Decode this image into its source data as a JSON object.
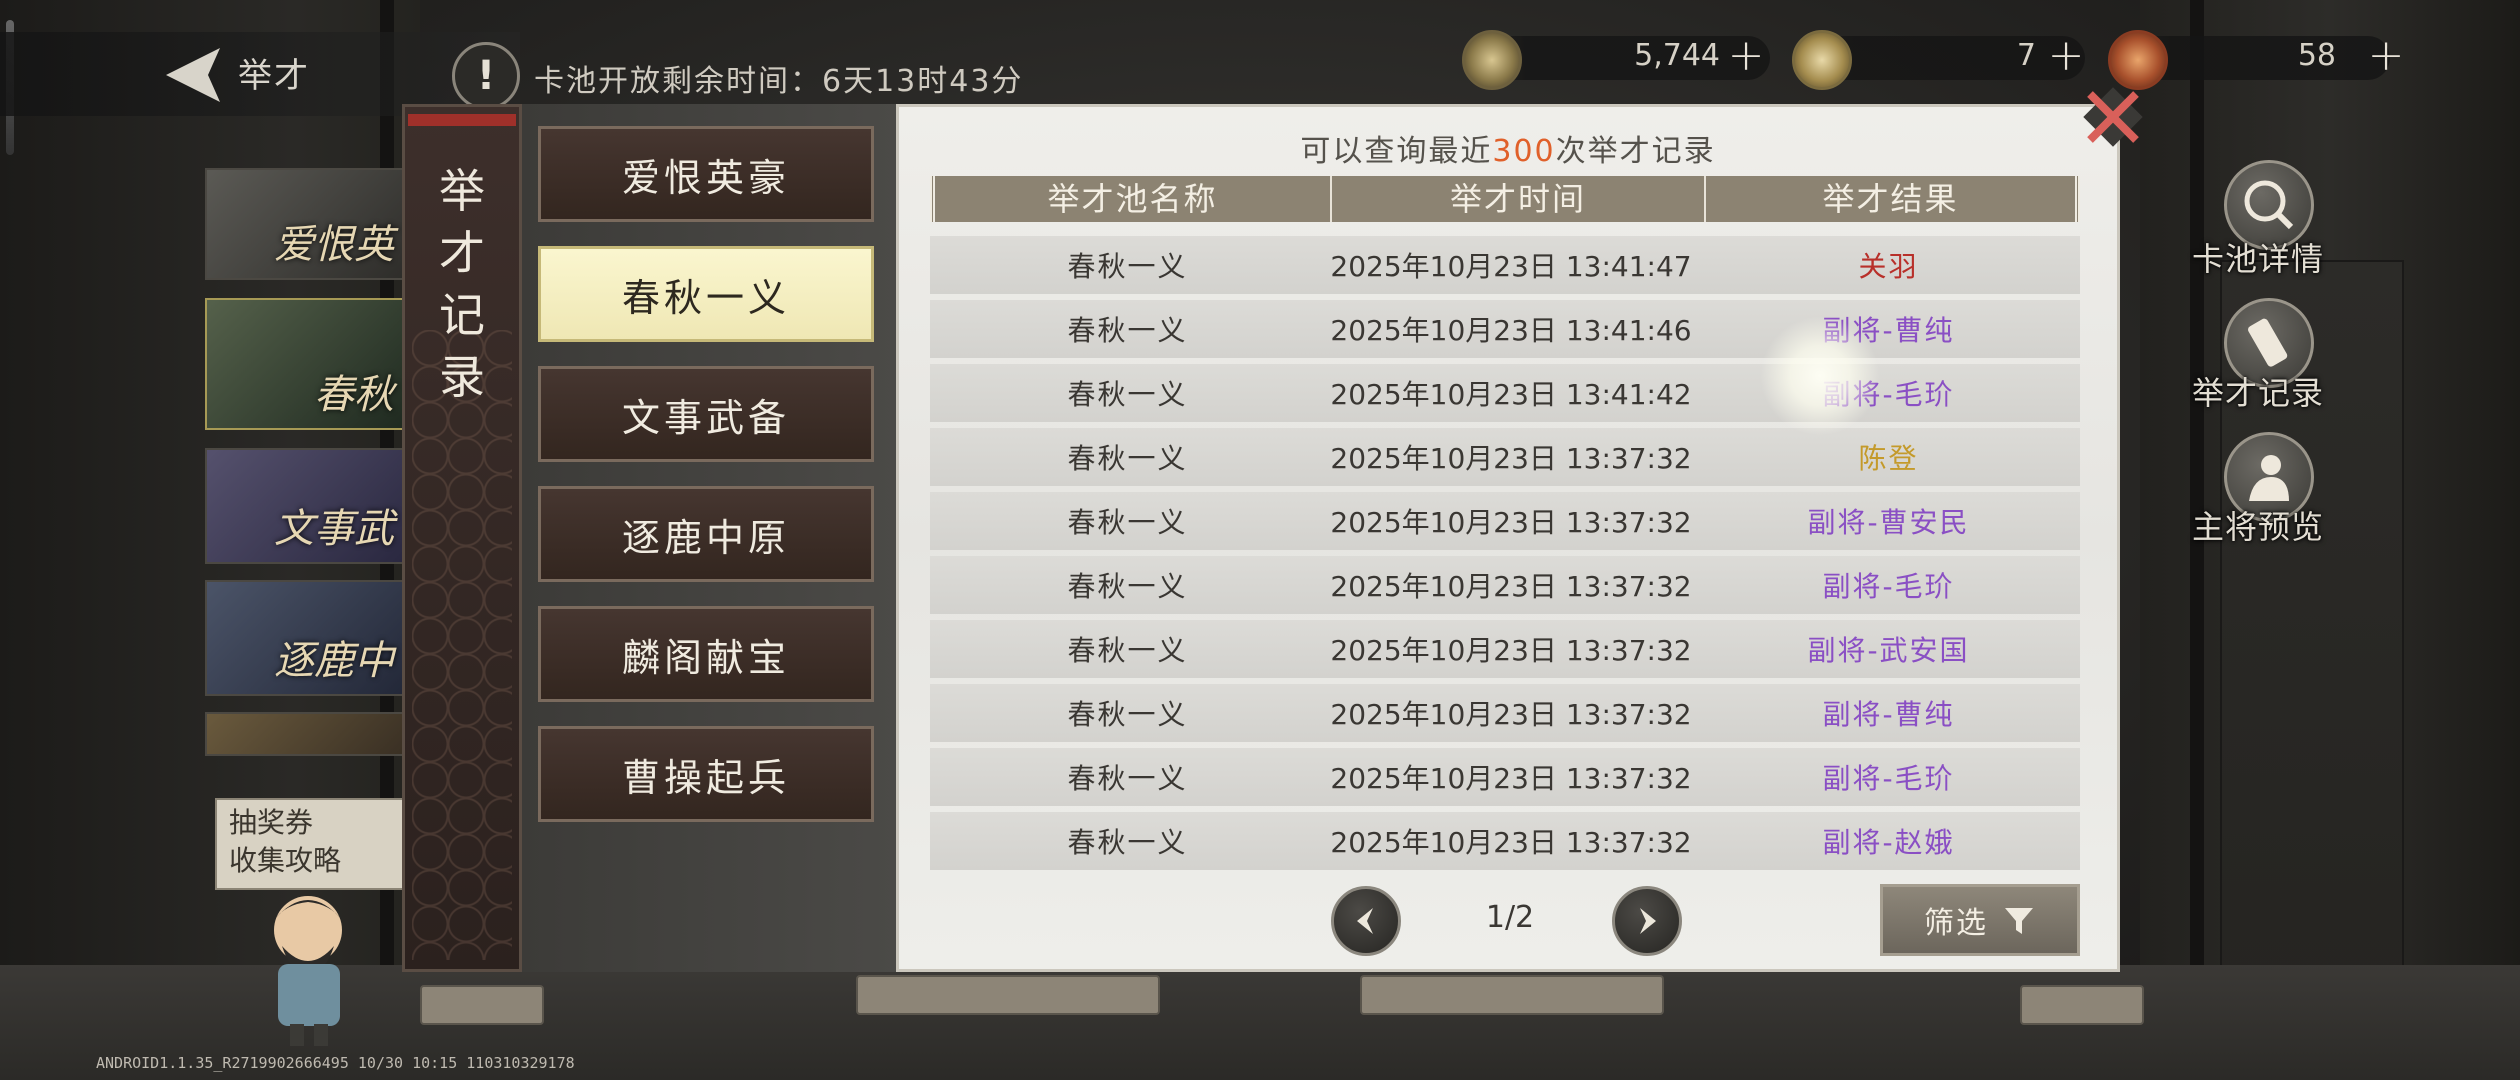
{
  "header": {
    "back_label": "举才",
    "warning_glyph": "!",
    "timer_text": "卡池开放剩余时间：6天13时43分"
  },
  "currencies": [
    {
      "icon": "copper-coin-icon",
      "value": "5,744",
      "plus": "+"
    },
    {
      "icon": "jade-token-icon",
      "value": "7",
      "plus": "+"
    },
    {
      "icon": "gold-ticket-icon",
      "value": "58",
      "plus": "+"
    }
  ],
  "side_buttons": [
    {
      "icon": "magnifier-icon",
      "label": "卡池详情"
    },
    {
      "icon": "scroll-icon",
      "label": "举才记录"
    },
    {
      "icon": "general-icon",
      "label": "主将预览"
    }
  ],
  "banners": [
    {
      "text": "爱恨英"
    },
    {
      "text": "春秋"
    },
    {
      "text": "文事武"
    },
    {
      "text": "逐鹿中"
    }
  ],
  "voucher": {
    "line1": "抽奖券",
    "line2": "收集攻略"
  },
  "modal": {
    "tab_title": "举才记录",
    "pools": [
      {
        "label": "爱恨英豪",
        "active": false
      },
      {
        "label": "春秋一义",
        "active": true
      },
      {
        "label": "文事武备",
        "active": false
      },
      {
        "label": "逐鹿中原",
        "active": false
      },
      {
        "label": "麟阁献宝",
        "active": false
      },
      {
        "label": "曹操起兵",
        "active": false
      }
    ],
    "note_prefix": "可以查询最近",
    "note_number": "300",
    "note_suffix": "次举才记录",
    "columns": [
      "举才池名称",
      "举才时间",
      "举才结果"
    ],
    "rows": [
      {
        "pool": "春秋一义",
        "time": "2025年10月23日 13:41:47",
        "result": "关羽",
        "color": "#b8302a"
      },
      {
        "pool": "春秋一义",
        "time": "2025年10月23日 13:41:46",
        "result": "副将-曹纯",
        "color": "#8a4fc4"
      },
      {
        "pool": "春秋一义",
        "time": "2025年10月23日 13:41:42",
        "result": "副将-毛玠",
        "color": "#8a4fc4"
      },
      {
        "pool": "春秋一义",
        "time": "2025年10月23日 13:37:32",
        "result": "陈登",
        "color": "#c49a2a"
      },
      {
        "pool": "春秋一义",
        "time": "2025年10月23日 13:37:32",
        "result": "副将-曹安民",
        "color": "#8a4fc4"
      },
      {
        "pool": "春秋一义",
        "time": "2025年10月23日 13:37:32",
        "result": "副将-毛玠",
        "color": "#8a4fc4"
      },
      {
        "pool": "春秋一义",
        "time": "2025年10月23日 13:37:32",
        "result": "副将-武安国",
        "color": "#8a4fc4"
      },
      {
        "pool": "春秋一义",
        "time": "2025年10月23日 13:37:32",
        "result": "副将-曹纯",
        "color": "#8a4fc4"
      },
      {
        "pool": "春秋一义",
        "time": "2025年10月23日 13:37:32",
        "result": "副将-毛玠",
        "color": "#8a4fc4"
      },
      {
        "pool": "春秋一义",
        "time": "2025年10月23日 13:37:32",
        "result": "副将-赵娥",
        "color": "#8a4fc4"
      }
    ],
    "pager": "1/2",
    "filter_label": "筛选"
  },
  "build_info": "ANDROID1.1.35_R2719902666495 10/30 10:15 110310329178"
}
